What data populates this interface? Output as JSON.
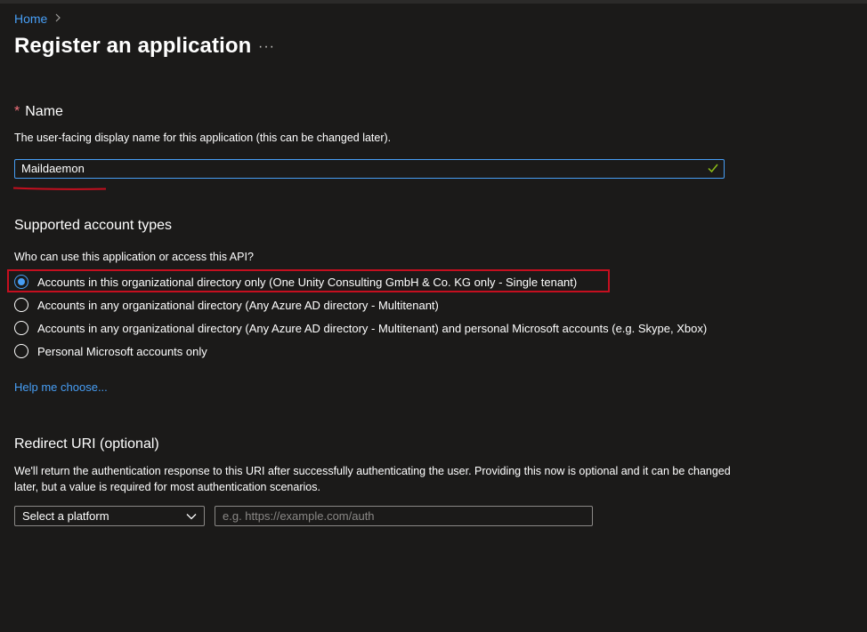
{
  "breadcrumb": {
    "home": "Home"
  },
  "header": {
    "title": "Register an application",
    "more": "···"
  },
  "name_section": {
    "required_marker": "*",
    "title": "Name",
    "description": "The user-facing display name for this application (this can be changed later).",
    "value": "Maildaemon"
  },
  "account_types": {
    "title": "Supported account types",
    "question": "Who can use this application or access this API?",
    "options": [
      {
        "label": "Accounts in this organizational directory only (One Unity Consulting GmbH & Co. KG only - Single tenant)",
        "selected": true
      },
      {
        "label": "Accounts in any organizational directory (Any Azure AD directory - Multitenant)",
        "selected": false
      },
      {
        "label": "Accounts in any organizational directory (Any Azure AD directory - Multitenant) and personal Microsoft accounts (e.g. Skype, Xbox)",
        "selected": false
      },
      {
        "label": "Personal Microsoft accounts only",
        "selected": false
      }
    ],
    "help_link": "Help me choose..."
  },
  "redirect": {
    "title": "Redirect URI (optional)",
    "description": "We'll return the authentication response to this URI after successfully authenticating the user. Providing this now is optional and it can be changed later, but a value is required for most authentication scenarios.",
    "platform_select": "Select a platform",
    "uri_placeholder": "e.g. https://example.com/auth"
  },
  "colors": {
    "background": "#1b1a19",
    "accent": "#479ef5",
    "highlight": "#c50f1f",
    "success": "#8cbd18"
  }
}
